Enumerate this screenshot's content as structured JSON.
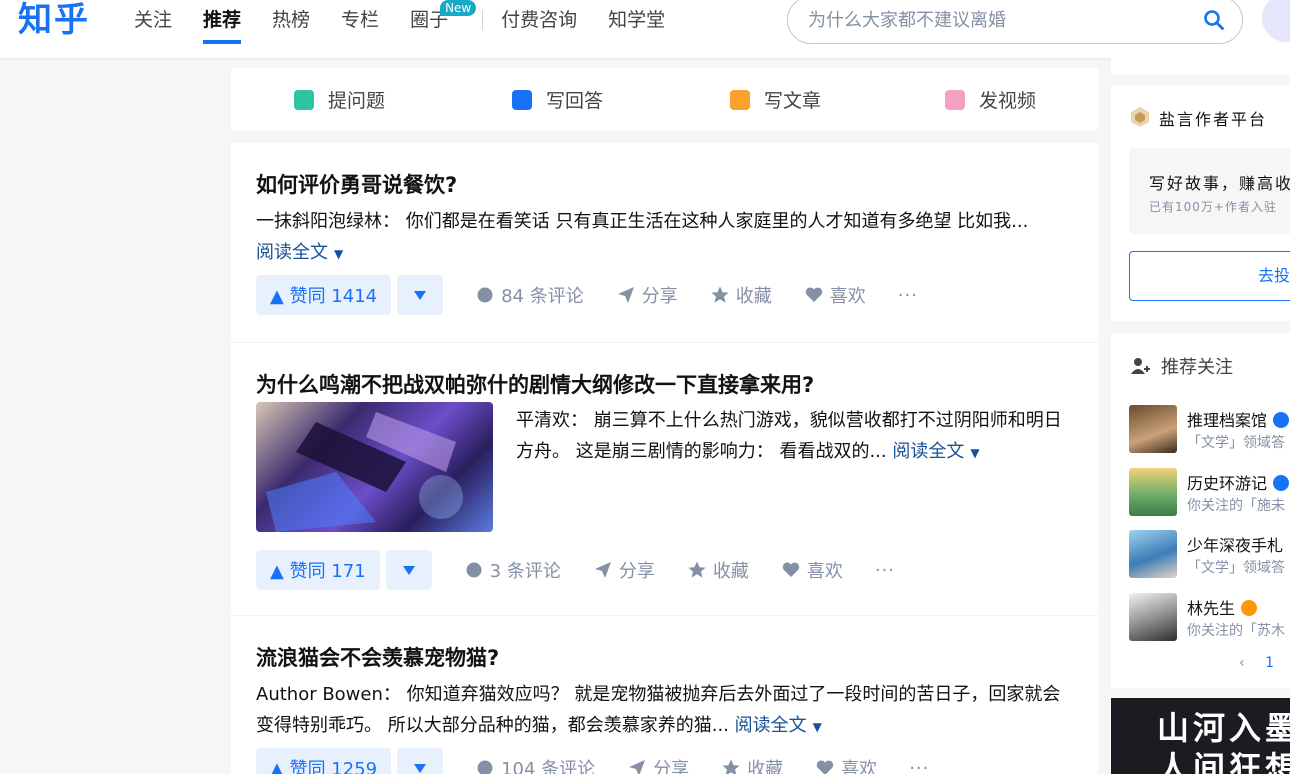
{
  "header": {
    "logo": "知乎",
    "nav": [
      "关注",
      "推荐",
      "热榜",
      "专栏",
      "圈子",
      "付费咨询",
      "知学堂"
    ],
    "new_badge": "New",
    "search_placeholder": "为什么大家都不建议离婚",
    "accent": "#1772f6"
  },
  "write_bar": {
    "ask": "提问题",
    "answer": "写回答",
    "article": "写文章",
    "video": "发视频"
  },
  "feed": [
    {
      "title": "如何评价勇哥说餐饮?",
      "author": "一抹斜阳泡绿林：",
      "excerpt": "你们都是在看笑话 只有真正生活在这种人家庭里的人才知道有多绝望 比如我...",
      "read_more": "阅读全文",
      "vote": "▲ 赞同 1414",
      "comments": "84 条评论",
      "share": "分享",
      "collect": "收藏",
      "like": "喜欢",
      "more": "···"
    },
    {
      "title": "为什么鸣潮不把战双帕弥什的剧情大纲修改一下直接拿来用?",
      "author": "平清欢：",
      "excerpt": "崩三算不上什么热门游戏，貌似营收都打不过阴阳师和明日方舟。 这是崩三剧情的影响力： 看看战双的...",
      "read_more": "阅读全文",
      "vote": "▲ 赞同 171",
      "comments": "3 条评论",
      "share": "分享",
      "collect": "收藏",
      "like": "喜欢",
      "more": "···"
    },
    {
      "title": "流浪猫会不会羡慕宠物猫?",
      "author": "Author Bowen：",
      "excerpt": "你知道弃猫效应吗？ 就是宠物猫被抛弃后去外面过了一段时间的苦日子，回家就会变得特别乖巧。 所以大部分品种的猫，都会羡慕家养的猫...",
      "read_more": "阅读全文",
      "vote": "▲ 赞同 1259",
      "comments": "104 条评论",
      "share": "分享",
      "collect": "收藏",
      "like": "喜欢",
      "more": "···"
    }
  ],
  "sidebar": {
    "creator_title": "盐言作者平台",
    "promo_title": "写好故事，赚高收",
    "promo_sub": "已有100万+作者入驻",
    "submit_button": "去投",
    "recommend_title": "推荐关注",
    "recommend": [
      {
        "name": "推理档案馆",
        "desc": "「文学」领域答",
        "verified": "blue"
      },
      {
        "name": "历史环游记",
        "desc": "你关注的「施未",
        "verified": "blue"
      },
      {
        "name": "少年深夜手札",
        "desc": "「文学」领域答",
        "verified": ""
      },
      {
        "name": "林先生",
        "desc": "你关注的「苏木",
        "verified": "orange"
      }
    ],
    "pager_prev": "‹",
    "pager_current": "1",
    "ad_text_1": "山河入墨",
    "ad_text_2": "人间狂想"
  }
}
